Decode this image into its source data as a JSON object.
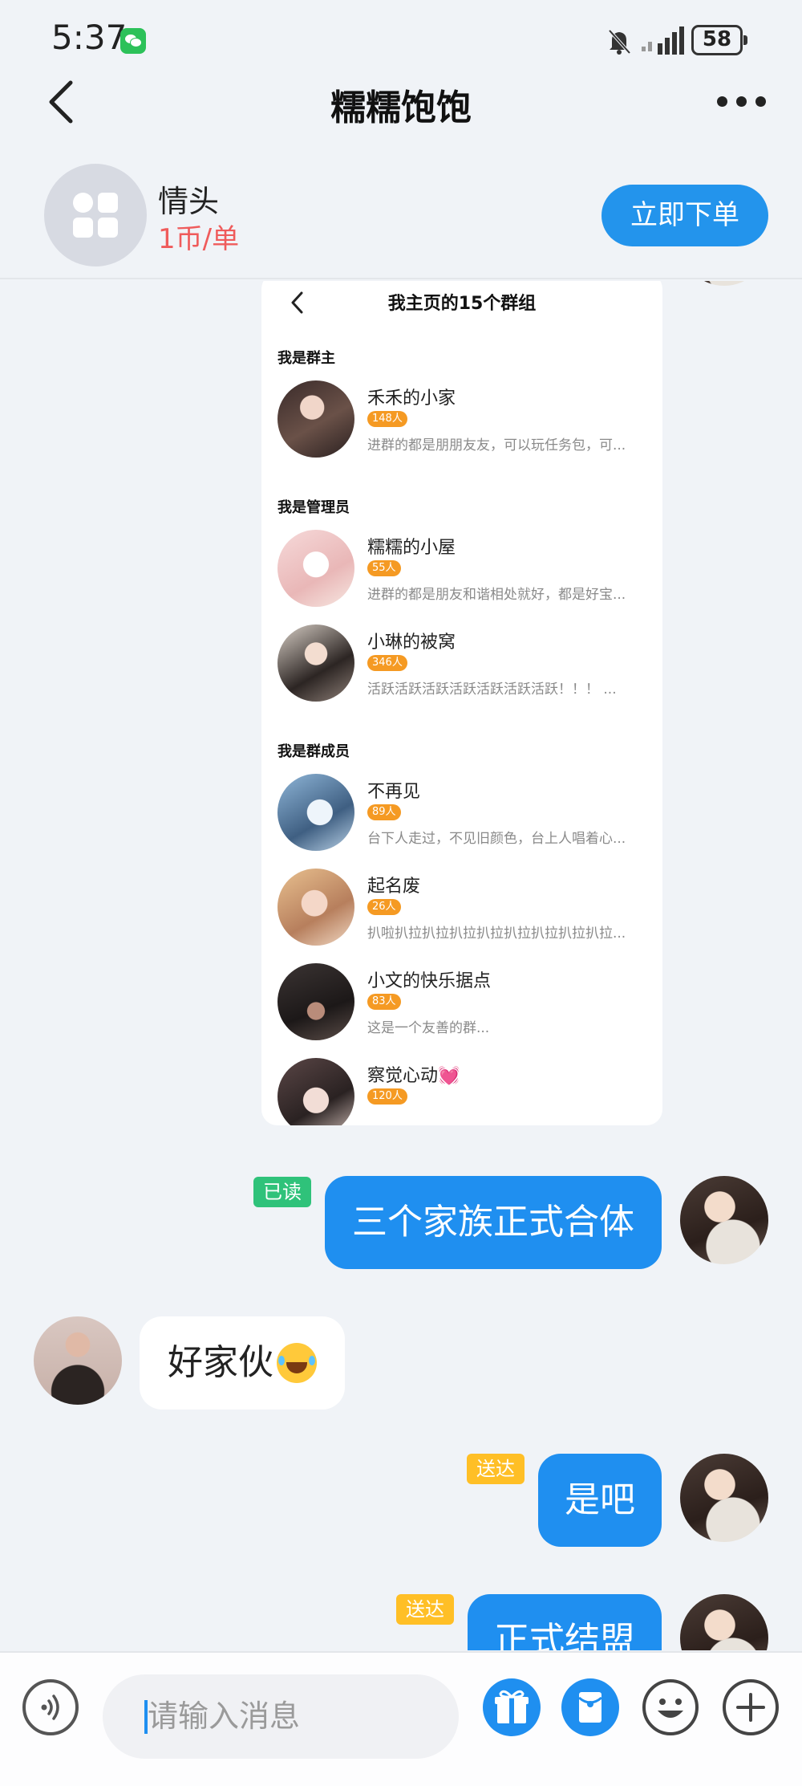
{
  "status_bar": {
    "time": "5:37",
    "battery": "58",
    "icons": [
      "wechat-icon",
      "bell-off-icon",
      "signal-icon",
      "battery-icon"
    ]
  },
  "nav": {
    "title": "糯糯饱饱"
  },
  "service": {
    "name": "情头",
    "price": "1币/单",
    "order_button": "立即下单"
  },
  "shared_screenshot": {
    "title": "我主页的15个群组",
    "sections": [
      {
        "heading": "我是群主",
        "groups": [
          {
            "name": "禾禾的小家",
            "count": "148人",
            "desc": "进群的都是朋朋友友，可以玩任务包，可..."
          }
        ]
      },
      {
        "heading": "我是管理员",
        "groups": [
          {
            "name": "糯糯的小屋",
            "count": "55人",
            "desc": "进群的都是朋友和谐相处就好，都是好宝..."
          },
          {
            "name": "小琳的被窝",
            "count": "346人",
            "desc": "活跃活跃活跃活跃活跃活跃活跃！！！ ..."
          }
        ]
      },
      {
        "heading": "我是群成员",
        "groups": [
          {
            "name": "不再见",
            "count": "89人",
            "desc": "台下人走过，不见旧颜色，台上人唱着心..."
          },
          {
            "name": "起名废",
            "count": "26人",
            "desc": "扒啦扒拉扒拉扒拉扒拉扒拉扒拉扒拉扒拉..."
          },
          {
            "name": "小文的快乐据点",
            "count": "83人",
            "desc": "这是一个友善的群..."
          },
          {
            "name": "察觉心动💓",
            "count": "120人",
            "desc": ""
          }
        ]
      }
    ]
  },
  "messages": [
    {
      "text": "三个家族正式合体",
      "status": "已读"
    },
    {
      "text": "好家伙"
    },
    {
      "text": "是吧",
      "status": "送达"
    },
    {
      "text": "正式结盟",
      "status": "送达"
    }
  ],
  "input": {
    "placeholder": "请输入消息"
  },
  "colors": {
    "accent": "#1f8ff0",
    "price": "#ef5b5b",
    "read_tag": "#2fc27a",
    "sent_tag": "#ffbf26",
    "count_badge": "#f59a23"
  }
}
